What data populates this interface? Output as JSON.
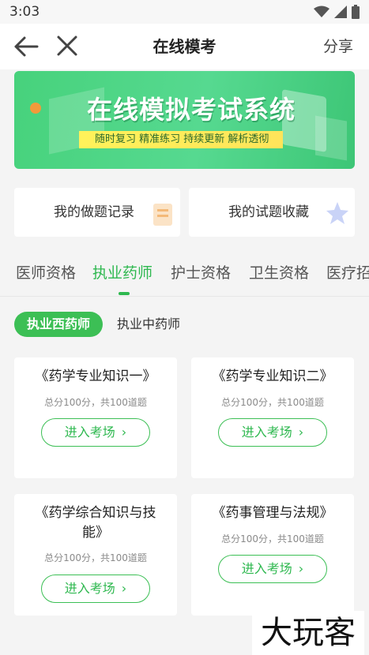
{
  "status_bar": {
    "time": "3:03"
  },
  "app_bar": {
    "title": "在线模考",
    "share_label": "分享"
  },
  "banner": {
    "title": "在线模拟考试系统",
    "subtitle": "随时复习 精准练习 持续更新 解析透彻"
  },
  "quick_links": [
    {
      "label": "我的做题记录",
      "icon": "clipboard-icon"
    },
    {
      "label": "我的试题收藏",
      "icon": "star-icon"
    }
  ],
  "tabs": [
    {
      "label": "医师资格"
    },
    {
      "label": "执业药师"
    },
    {
      "label": "护士资格"
    },
    {
      "label": "卫生资格"
    },
    {
      "label": "医疗招"
    }
  ],
  "active_tab": "执业药师",
  "chips": [
    {
      "label": "执业西药师"
    },
    {
      "label": "执业中药师"
    }
  ],
  "active_chip": "执业西药师",
  "exams": [
    {
      "title": "《药学专业知识一》",
      "meta": "总分100分，共100道题",
      "button": "进入考场"
    },
    {
      "title": "《药学专业知识二》",
      "meta": "总分100分，共100道题",
      "button": "进入考场"
    },
    {
      "title": "《药学综合知识与技能》",
      "meta": "总分100分，共100道题",
      "button": "进入考场"
    },
    {
      "title": "《药事管理与法规》",
      "meta": "总分100分，共100道题",
      "button": "进入考场"
    }
  ],
  "watermark": "大玩客",
  "colors": {
    "accent": "#3cbf55",
    "background": "#f4f4f4"
  }
}
